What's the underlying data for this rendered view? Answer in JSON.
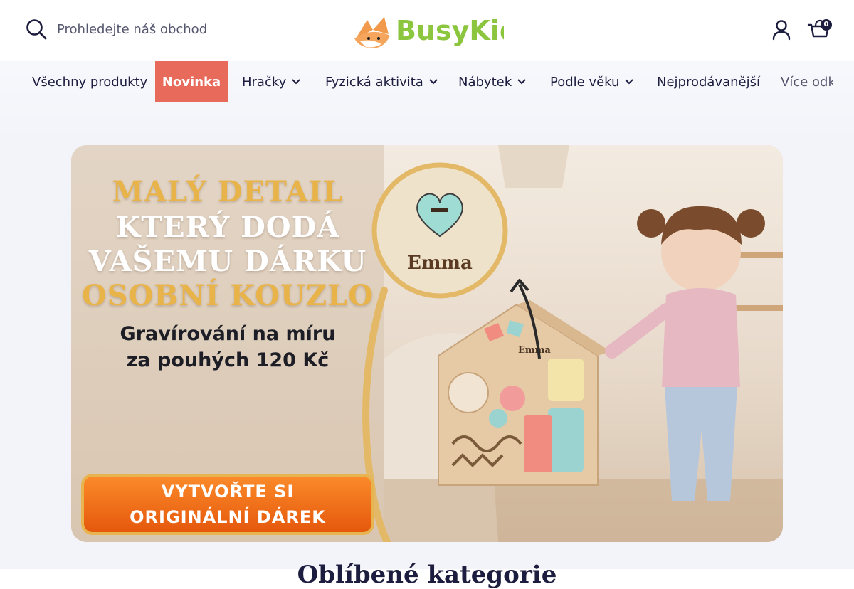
{
  "header": {
    "search_placeholder": "Prohledejte náš obchod",
    "logo_text": "BusyKids",
    "cart_count": "0",
    "icons": [
      "search-icon",
      "logo-fox-icon",
      "account-icon",
      "cart-icon"
    ]
  },
  "nav": {
    "items": [
      {
        "label": "Všechny produkty",
        "dropdown": false
      },
      {
        "label": "Novinka",
        "dropdown": false,
        "active": true
      },
      {
        "label": "Hračky",
        "dropdown": true
      },
      {
        "label": "Fyzická aktivita",
        "dropdown": true
      },
      {
        "label": "Nábytek",
        "dropdown": true
      },
      {
        "label": "Podle věku",
        "dropdown": true
      },
      {
        "label": "Nejprodávanější",
        "dropdown": false
      }
    ],
    "more_label": "Více odkazů",
    "active_color": "#e86a5a"
  },
  "banner": {
    "heading_lines": [
      "MALÝ DETAIL",
      "KTERÝ DODÁ",
      "VAŠEMU DÁRKU",
      "OSOBNÍ KOUZLO"
    ],
    "subheading_lines": [
      "Gravírování na míru",
      "za pouhých 120 Kč"
    ],
    "engraving_name": "Emma",
    "house_name": "Emma",
    "cta_lines": [
      "VYTVOŘTE SI",
      "ORIGINÁLNÍ DÁREK"
    ],
    "colors": {
      "gold": "#e8b44a",
      "cta": "#f07a1e"
    }
  },
  "next_section_heading": "Oblíbené kategorie"
}
